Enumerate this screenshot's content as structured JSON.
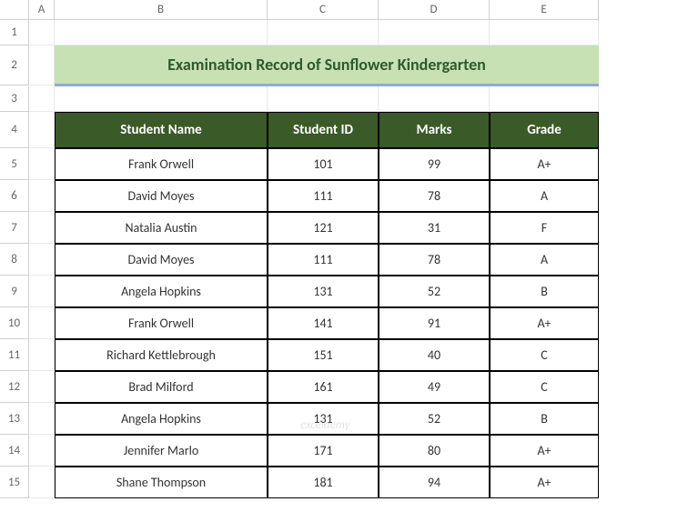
{
  "columns": [
    "A",
    "B",
    "C",
    "D",
    "E"
  ],
  "rowNumbers": [
    1,
    2,
    3,
    4,
    5,
    6,
    7,
    8,
    9,
    10,
    11,
    12,
    13,
    14,
    15
  ],
  "title": "Examination Record of Sunflower Kindergarten",
  "headers": {
    "name": "Student Name",
    "id": "Student ID",
    "marks": "Marks",
    "grade": "Grade"
  },
  "chart_data": {
    "type": "table",
    "title": "Examination Record of Sunflower Kindergarten",
    "columns": [
      "Student Name",
      "Student ID",
      "Marks",
      "Grade"
    ],
    "rows": [
      {
        "name": "Frank Orwell",
        "id": 101,
        "marks": 99,
        "grade": "A+"
      },
      {
        "name": "David Moyes",
        "id": 111,
        "marks": 78,
        "grade": "A"
      },
      {
        "name": "Natalia Austin",
        "id": 121,
        "marks": 31,
        "grade": "F"
      },
      {
        "name": "David Moyes",
        "id": 111,
        "marks": 78,
        "grade": "A"
      },
      {
        "name": "Angela Hopkins",
        "id": 131,
        "marks": 52,
        "grade": "B"
      },
      {
        "name": "Frank Orwell",
        "id": 141,
        "marks": 91,
        "grade": "A+"
      },
      {
        "name": "Richard Kettlebrough",
        "id": 151,
        "marks": 40,
        "grade": "C"
      },
      {
        "name": "Brad Milford",
        "id": 161,
        "marks": 49,
        "grade": "C"
      },
      {
        "name": "Angela Hopkins",
        "id": 131,
        "marks": 52,
        "grade": "B"
      },
      {
        "name": "Jennifer Marlo",
        "id": 171,
        "marks": 80,
        "grade": "A+"
      },
      {
        "name": "Shane Thompson",
        "id": 181,
        "marks": 94,
        "grade": "A+"
      }
    ]
  },
  "watermark": "exceldemy"
}
